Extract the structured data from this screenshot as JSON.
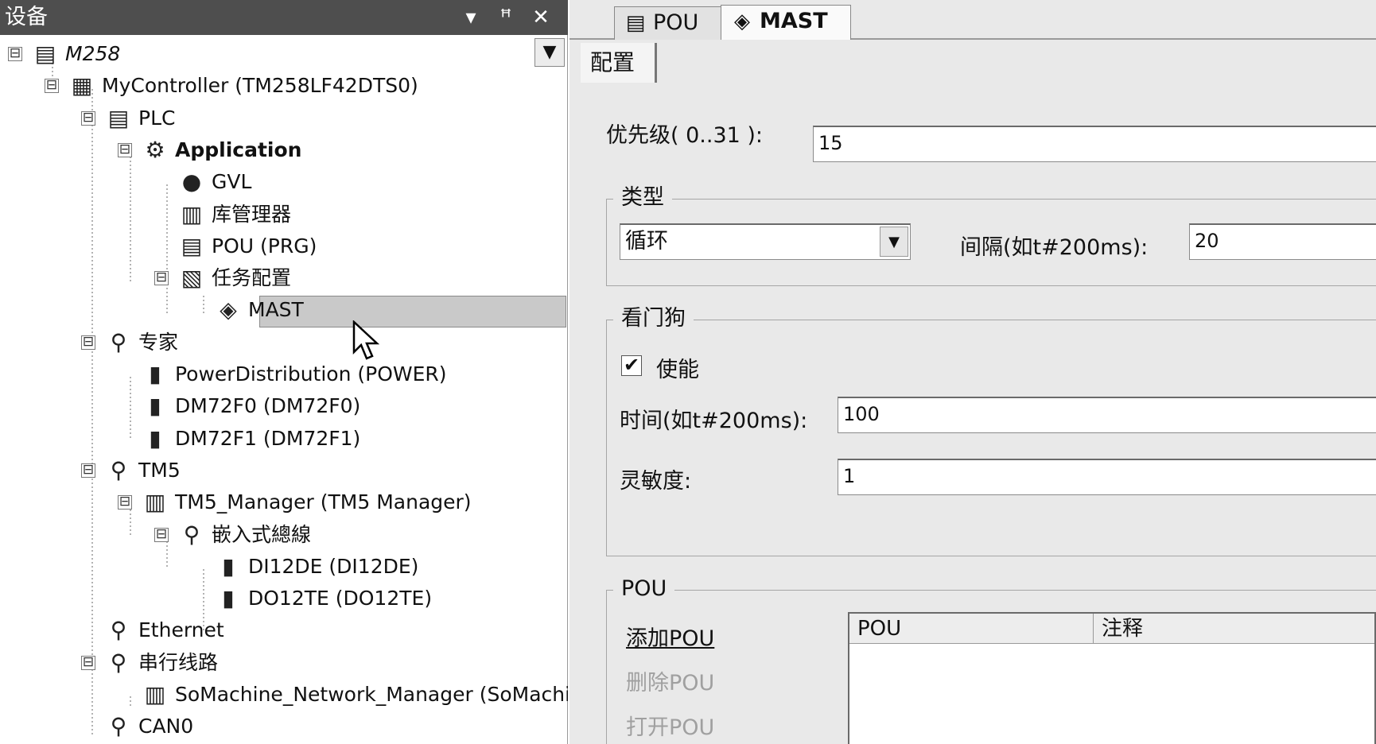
{
  "device_pane": {
    "title": "设备",
    "controls": {
      "dropdown": "▾",
      "pin": "ꟸ",
      "close": "✕"
    },
    "combo_arrow": "▼"
  },
  "tree": [
    {
      "label": "M258",
      "icon": "project-icon",
      "glyph": "▤",
      "expander": "⊟"
    },
    {
      "label": "MyController (TM258LF42DTS0)",
      "icon": "controller-icon",
      "glyph": "▦",
      "expander": "⊟"
    },
    {
      "label": "PLC",
      "icon": "plc-icon",
      "glyph": "▤",
      "expander": "⊟"
    },
    {
      "label": "Application",
      "icon": "gear-icon",
      "glyph": "⚙",
      "expander": "⊟"
    },
    {
      "label": "GVL",
      "icon": "globe-icon",
      "glyph": "●",
      "expander": ""
    },
    {
      "label": "库管理器",
      "icon": "library-icon",
      "glyph": "▥",
      "expander": ""
    },
    {
      "label": "POU (PRG)",
      "icon": "pou-icon",
      "glyph": "▤",
      "expander": ""
    },
    {
      "label": "任务配置",
      "icon": "task-config-icon",
      "glyph": "▧",
      "expander": "⊟"
    },
    {
      "label": "MAST",
      "icon": "task-icon",
      "glyph": "◈",
      "expander": ""
    },
    {
      "label": "专家",
      "icon": "expert-icon",
      "glyph": "⚲",
      "expander": "⊟"
    },
    {
      "label": "PowerDistribution (POWER)",
      "icon": "module-icon",
      "glyph": "▮",
      "expander": ""
    },
    {
      "label": "DM72F0 (DM72F0)",
      "icon": "module-icon",
      "glyph": "▮",
      "expander": ""
    },
    {
      "label": "DM72F1 (DM72F1)",
      "icon": "module-icon",
      "glyph": "▮",
      "expander": ""
    },
    {
      "label": "TM5",
      "icon": "bus-icon",
      "glyph": "⚲",
      "expander": "⊟"
    },
    {
      "label": "TM5_Manager (TM5 Manager)",
      "icon": "manager-icon",
      "glyph": "▥",
      "expander": "⊟"
    },
    {
      "label": "嵌入式總線",
      "icon": "bus-icon",
      "glyph": "⚲",
      "expander": "⊟"
    },
    {
      "label": "DI12DE (DI12DE)",
      "icon": "input-module-icon",
      "glyph": "▮",
      "expander": ""
    },
    {
      "label": "DO12TE (DO12TE)",
      "icon": "output-module-icon",
      "glyph": "▮",
      "expander": ""
    },
    {
      "label": "Ethernet",
      "icon": "ethernet-icon",
      "glyph": "⚲",
      "expander": ""
    },
    {
      "label": "串行线路",
      "icon": "serial-icon",
      "glyph": "⚲",
      "expander": "⊟"
    },
    {
      "label": "SoMachine_Network_Manager (SoMachine",
      "icon": "network-manager-icon",
      "glyph": "▥",
      "expander": ""
    },
    {
      "label": "CAN0",
      "icon": "can-icon",
      "glyph": "⚲",
      "expander": ""
    }
  ],
  "editor": {
    "tabs": [
      {
        "label": "POU",
        "glyph": "▤"
      },
      {
        "label": "MAST",
        "glyph": "◈"
      }
    ],
    "subtab": "配置",
    "priority": {
      "label": "优先级( 0..31 ):",
      "value": "15"
    },
    "type_group": {
      "title": "类型",
      "type_value": "循环",
      "interval_label": "间隔(如t#200ms):",
      "interval_value": "20",
      "combo_arrow": "▼"
    },
    "watchdog_group": {
      "title": "看门狗",
      "enable_label": "使能",
      "enable_checked": "✔",
      "time_label": "时间(如t#200ms):",
      "time_value": "100",
      "sensitivity_label": "灵敏度:",
      "sensitivity_value": "1"
    },
    "pou_group": {
      "title": "POU",
      "add": "添加POU",
      "delete": "删除POU",
      "open": "打开POU",
      "columns": [
        "POU",
        "注释"
      ]
    }
  }
}
